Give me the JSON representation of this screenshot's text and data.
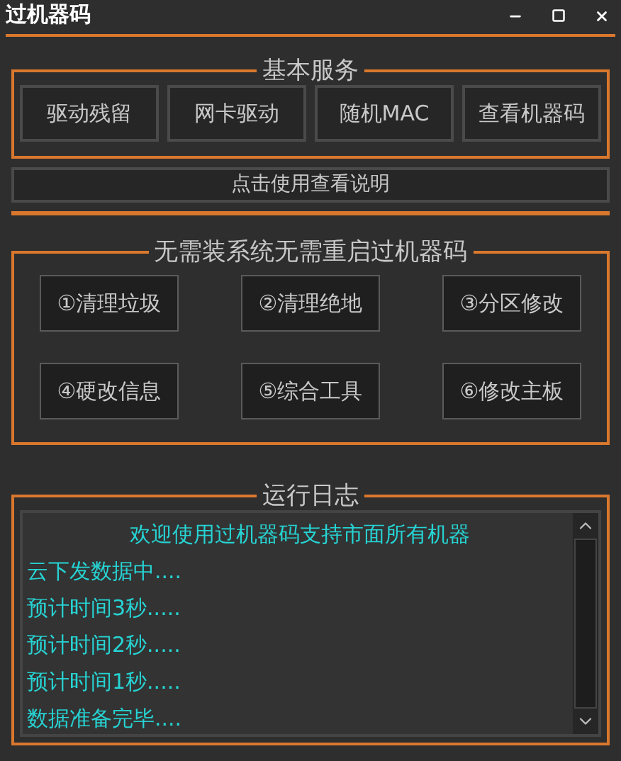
{
  "window": {
    "title": "过机器码"
  },
  "basic_services": {
    "title": "基本服务",
    "buttons": [
      "驱动残留",
      "网卡驱动",
      "随机MAC",
      "查看机器码"
    ]
  },
  "help_button": {
    "label": "点击使用查看说明"
  },
  "no_reinstall": {
    "title": "无需装系统无需重启过机器码",
    "buttons": [
      "①清理垃圾",
      "②清理绝地",
      "③分区修改",
      "④硬改信息",
      "⑤综合工具",
      "⑥修改主板"
    ]
  },
  "run_log": {
    "title": "运行日志",
    "welcome": "欢迎使用过机器码支持市面所有机器",
    "lines": [
      "云下发数据中....",
      "预计时间3秒.....",
      "预计时间2秒.....",
      "预计时间1秒.....",
      "数据准备完毕...."
    ]
  }
}
